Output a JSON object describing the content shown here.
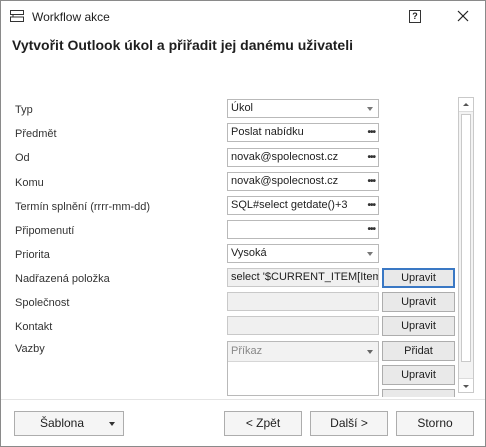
{
  "window": {
    "title": "Workflow akce",
    "help_label": "?",
    "heading": "Vytvořit Outlook úkol a přiřadit jej danému uživateli"
  },
  "form": {
    "typ": {
      "label": "Typ",
      "value": "Úkol"
    },
    "predmet": {
      "label": "Předmět",
      "value": "Poslat nabídku"
    },
    "od": {
      "label": "Od",
      "value": "novak@spolecnost.cz"
    },
    "komu": {
      "label": "Komu",
      "value": "novak@spolecnost.cz"
    },
    "termin": {
      "label": "Termín splnění (rrrr-mm-dd)",
      "value": "SQL#select getdate()+3"
    },
    "pripomenuti": {
      "label": "Připomenutí",
      "value": ""
    },
    "priorita": {
      "label": "Priorita",
      "value": "Vysoká"
    },
    "nadrazena": {
      "label": "Nadřazená položka",
      "value": "select '$CURRENT_ITEM[Item]"
    },
    "spolecnost": {
      "label": "Společnost",
      "value": ""
    },
    "kontakt": {
      "label": "Kontakt",
      "value": ""
    },
    "vazby": {
      "label": "Vazby",
      "column_header": "Příkaz"
    }
  },
  "side_buttons": {
    "upravit": "Upravit",
    "pridat": "Přidat"
  },
  "footer": {
    "sablona": "Šablona",
    "zpet": "< Zpět",
    "dalsi": "Další >",
    "storno": "Storno"
  }
}
